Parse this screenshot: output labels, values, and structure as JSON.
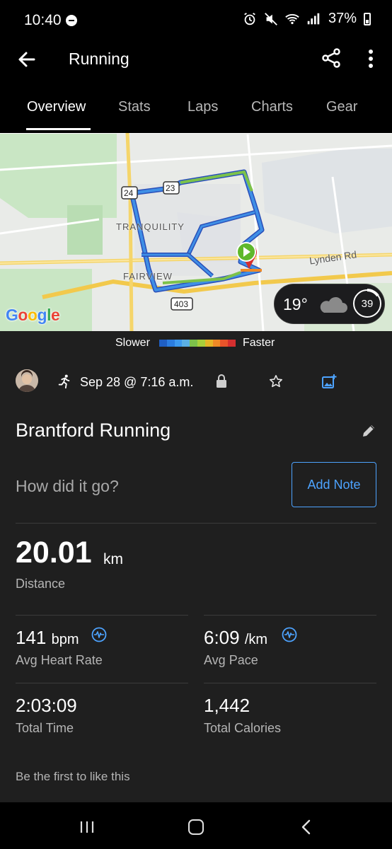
{
  "status_bar": {
    "time": "10:40",
    "battery": "37%"
  },
  "app_bar": {
    "title": "Running"
  },
  "tabs": [
    {
      "label": "Overview",
      "active": true
    },
    {
      "label": "Stats",
      "active": false
    },
    {
      "label": "Laps",
      "active": false
    },
    {
      "label": "Charts",
      "active": false
    },
    {
      "label": "Gear",
      "active": false
    }
  ],
  "map": {
    "labels": {
      "tranquility": "TRANQUILITY",
      "fairview": "FAIRVIEW",
      "lynden": "Lynden Rd",
      "route_24": "24",
      "route_23": "23",
      "route_403": "403"
    },
    "attribution": "Google",
    "weather": {
      "temp": "19°",
      "condition_icon": "cloud-icon",
      "value": "39"
    }
  },
  "pace_legend": {
    "slower": "Slower",
    "faster": "Faster",
    "colors": [
      "#1f5fc4",
      "#2b7de0",
      "#3d9aef",
      "#5bb0e6",
      "#7cc24a",
      "#a9cf3a",
      "#e5b527",
      "#ef8a26",
      "#e8542a",
      "#d42f2f"
    ]
  },
  "activity": {
    "date": "Sep 28 @ 7:16 a.m.",
    "name": "Brantford Running",
    "note_prompt": "How did it go?",
    "add_note_label": "Add Note"
  },
  "stats": {
    "distance": {
      "value": "20.01",
      "unit": "km",
      "label": "Distance"
    },
    "heart_rate": {
      "value": "141",
      "unit": "bpm",
      "label": "Avg Heart Rate"
    },
    "pace": {
      "value": "6:09",
      "unit": "/km",
      "label": "Avg Pace"
    },
    "time": {
      "value": "2:03:09",
      "label": "Total Time"
    },
    "calories": {
      "value": "1,442",
      "label": "Total Calories"
    }
  },
  "social": {
    "like_text": "Be the first to like this"
  },
  "colors": {
    "accent": "#4da3ff",
    "background": "#1f1f1f"
  }
}
